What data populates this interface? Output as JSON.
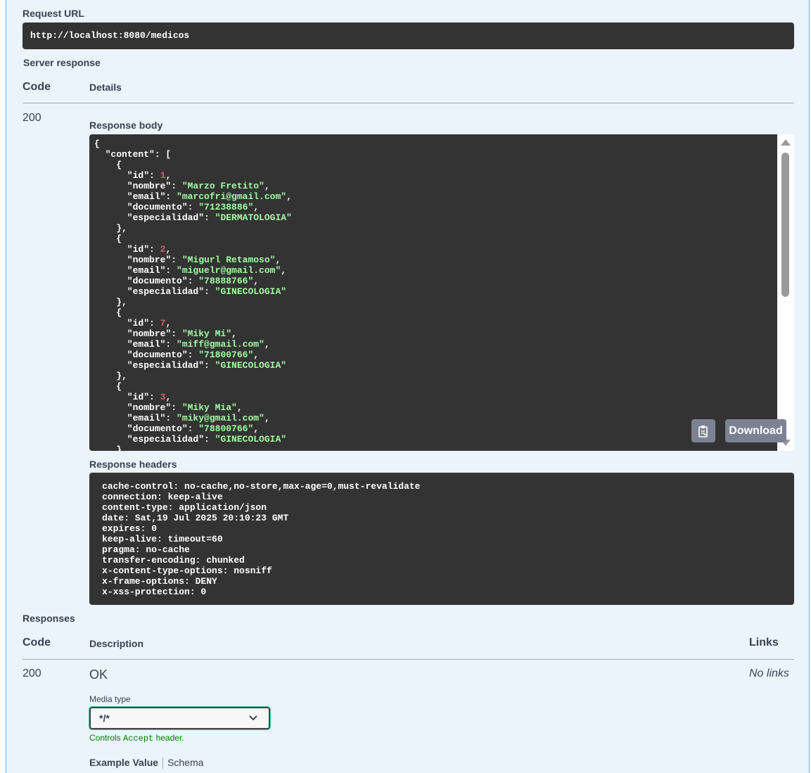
{
  "request_url": {
    "label": "Request URL",
    "value": "http://localhost:8080/medicos"
  },
  "server_response": {
    "label": "Server response",
    "col_code": "Code",
    "col_details": "Details",
    "code": "200",
    "body_label": "Response body",
    "body_lines": [
      [
        [
          "k",
          "{"
        ]
      ],
      [
        [
          "k",
          "  \"content\": ["
        ]
      ],
      [
        [
          "k",
          "    {"
        ]
      ],
      [
        [
          "k",
          "      \"id\": "
        ],
        [
          "n",
          "1"
        ],
        [
          "k",
          ","
        ]
      ],
      [
        [
          "k",
          "      \"nombre\": "
        ],
        [
          "s",
          "\"Marzo Fretito\""
        ],
        [
          "k",
          ","
        ]
      ],
      [
        [
          "k",
          "      \"email\": "
        ],
        [
          "s",
          "\"marcofri@gmail.com\""
        ],
        [
          "k",
          ","
        ]
      ],
      [
        [
          "k",
          "      \"documento\": "
        ],
        [
          "s",
          "\"71238886\""
        ],
        [
          "k",
          ","
        ]
      ],
      [
        [
          "k",
          "      \"especialidad\": "
        ],
        [
          "s",
          "\"DERMATOLOGIA\""
        ]
      ],
      [
        [
          "k",
          "    },"
        ]
      ],
      [
        [
          "k",
          "    {"
        ]
      ],
      [
        [
          "k",
          "      \"id\": "
        ],
        [
          "n",
          "2"
        ],
        [
          "k",
          ","
        ]
      ],
      [
        [
          "k",
          "      \"nombre\": "
        ],
        [
          "s",
          "\"Migurl Retamoso\""
        ],
        [
          "k",
          ","
        ]
      ],
      [
        [
          "k",
          "      \"email\": "
        ],
        [
          "s",
          "\"miguelr@gmail.com\""
        ],
        [
          "k",
          ","
        ]
      ],
      [
        [
          "k",
          "      \"documento\": "
        ],
        [
          "s",
          "\"78888766\""
        ],
        [
          "k",
          ","
        ]
      ],
      [
        [
          "k",
          "      \"especialidad\": "
        ],
        [
          "s",
          "\"GINECOLOGIA\""
        ]
      ],
      [
        [
          "k",
          "    },"
        ]
      ],
      [
        [
          "k",
          "    {"
        ]
      ],
      [
        [
          "k",
          "      \"id\": "
        ],
        [
          "n",
          "7"
        ],
        [
          "k",
          ","
        ]
      ],
      [
        [
          "k",
          "      \"nombre\": "
        ],
        [
          "s",
          "\"Miky Mi\""
        ],
        [
          "k",
          ","
        ]
      ],
      [
        [
          "k",
          "      \"email\": "
        ],
        [
          "s",
          "\"miff@gmail.com\""
        ],
        [
          "k",
          ","
        ]
      ],
      [
        [
          "k",
          "      \"documento\": "
        ],
        [
          "s",
          "\"71800766\""
        ],
        [
          "k",
          ","
        ]
      ],
      [
        [
          "k",
          "      \"especialidad\": "
        ],
        [
          "s",
          "\"GINECOLOGIA\""
        ]
      ],
      [
        [
          "k",
          "    },"
        ]
      ],
      [
        [
          "k",
          "    {"
        ]
      ],
      [
        [
          "k",
          "      \"id\": "
        ],
        [
          "n",
          "3"
        ],
        [
          "k",
          ","
        ]
      ],
      [
        [
          "k",
          "      \"nombre\": "
        ],
        [
          "s",
          "\"Miky Mia\""
        ],
        [
          "k",
          ","
        ]
      ],
      [
        [
          "k",
          "      \"email\": "
        ],
        [
          "s",
          "\"miky@gmail.com\""
        ],
        [
          "k",
          ","
        ]
      ],
      [
        [
          "k",
          "      \"documento\": "
        ],
        [
          "s",
          "\"78800766\""
        ],
        [
          "k",
          ","
        ]
      ],
      [
        [
          "k",
          "      \"especialidad\": "
        ],
        [
          "s",
          "\"GINECOLOGIA\""
        ]
      ],
      [
        [
          "k",
          "    }"
        ]
      ]
    ],
    "copy_icon": "clipboard-icon",
    "download_label": "Download",
    "headers_label": "Response headers",
    "headers": [
      "cache-control: no-cache,no-store,max-age=0,must-revalidate",
      "connection: keep-alive",
      "content-type: application/json",
      "date: Sat,19 Jul 2025 20:10:23 GMT",
      "expires: 0",
      "keep-alive: timeout=60",
      "pragma: no-cache",
      "transfer-encoding: chunked",
      "x-content-type-options: nosniff",
      "x-frame-options: DENY",
      "x-xss-protection: 0"
    ]
  },
  "responses": {
    "label": "Responses",
    "col_code": "Code",
    "col_description": "Description",
    "col_links": "Links",
    "code": "200",
    "description": "OK",
    "links": "No links",
    "media_type_label": "Media type",
    "media_type_value": "*/*",
    "controls_prefix": "Controls ",
    "controls_code": "Accept",
    "controls_suffix": " header.",
    "tab_example": "Example Value",
    "tab_schema": "Schema"
  },
  "colors": {
    "panel_bg": "#ebf3fb",
    "panel_border": "#61affe",
    "code_bg": "#333333",
    "string": "#a2fca2",
    "number": "#d36363",
    "button_bg": "#7d8293",
    "controls_text": "#008000"
  }
}
